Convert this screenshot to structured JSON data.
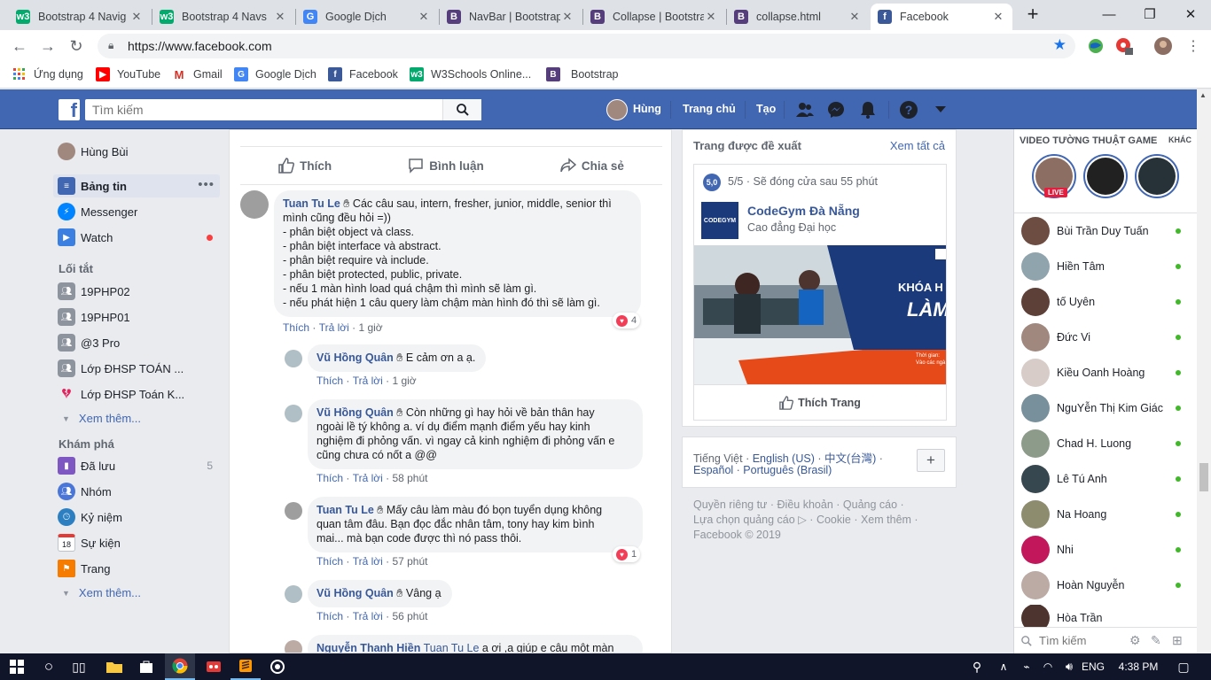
{
  "browser": {
    "tabs": [
      {
        "title": "Bootstrap 4 Navig",
        "favicon": "w3schools-icon",
        "color": "#04aa6d"
      },
      {
        "title": "Bootstrap 4 Navs",
        "favicon": "w3schools-icon",
        "color": "#04aa6d"
      },
      {
        "title": "Google Dịch",
        "favicon": "google-translate-icon",
        "color": "#4285f4"
      },
      {
        "title": "NavBar | Bootstrap",
        "favicon": "bootstrap-icon",
        "color": "#563d7c"
      },
      {
        "title": "Collapse | Bootstra",
        "favicon": "bootstrap-icon",
        "color": "#563d7c"
      },
      {
        "title": "collapse.html",
        "favicon": "bootstrap-icon",
        "color": "#563d7c"
      },
      {
        "title": "Facebook",
        "favicon": "facebook-icon",
        "color": "#3b5998"
      }
    ],
    "url": "https://www.facebook.com",
    "bookmarks": [
      {
        "label": "Ứng dụng",
        "icon": "apps-grid-icon",
        "color": "#ea4335"
      },
      {
        "label": "YouTube",
        "icon": "youtube-icon",
        "color": "#ff0000"
      },
      {
        "label": "Gmail",
        "icon": "gmail-icon",
        "color": "#d93025"
      },
      {
        "label": "Google Dịch",
        "icon": "google-translate-icon",
        "color": "#4285f4"
      },
      {
        "label": "Facebook",
        "icon": "facebook-icon",
        "color": "#3b5998"
      },
      {
        "label": "W3Schools Online...",
        "icon": "w3schools-icon",
        "color": "#04aa6d"
      },
      {
        "label": "Bootstrap",
        "icon": "bootstrap-icon",
        "color": "#563d7c"
      }
    ]
  },
  "fb": {
    "search_placeholder": "Tìm kiếm",
    "user_name": "Hùng",
    "nav_home": "Trang chủ",
    "nav_create": "Tạo",
    "brand_color": "#4267b2"
  },
  "leftnav": {
    "profile": "Hùng Bùi",
    "main": [
      {
        "label": "Bảng tin",
        "icon": "news-feed-icon"
      },
      {
        "label": "Messenger",
        "icon": "messenger-icon"
      },
      {
        "label": "Watch",
        "icon": "watch-icon"
      }
    ],
    "shortcuts_title": "Lối tắt",
    "shortcuts": [
      "19PHP02",
      "19PHP01",
      "@3 Pro",
      "Lớp ĐHSP TOÁN ...",
      "Lớp ĐHSP Toán K..."
    ],
    "see_more": "Xem thêm...",
    "explore_title": "Khám phá",
    "explore": [
      {
        "label": "Đã lưu",
        "icon": "saved-icon",
        "count": "5"
      },
      {
        "label": "Nhóm",
        "icon": "groups-icon",
        "count": ""
      },
      {
        "label": "Kỷ niệm",
        "icon": "memories-icon",
        "count": ""
      },
      {
        "label": "Sự kiện",
        "icon": "events-icon",
        "count": ""
      },
      {
        "label": "Trang",
        "icon": "pages-icon",
        "count": ""
      }
    ],
    "see_more2": "Xem thêm..."
  },
  "post": {
    "actions": {
      "like": "Thích",
      "comment": "Bình luận",
      "share": "Chia sẻ"
    },
    "comments": [
      {
        "name": "Tuan Tu Le",
        "lines": [
          "Các câu sau, intern, fresher, junior, middle, senior thì",
          "mình cũng đều hỏi =))",
          "- phân biệt object và class.",
          "- phân biệt interface và abstract.",
          "- phân biệt require và include.",
          "- phân biệt protected, public, private.",
          "- nếu 1 màn hình load quá chậm thì mình sẽ làm gì.",
          "- nếu phát hiện 1 câu query làm chậm màn hình đó thì sẽ làm gì."
        ],
        "like": "Thích",
        "reply": "Trả lời",
        "time": "1 giờ",
        "reactions": "4"
      },
      {
        "name": "Vũ Hồng Quân",
        "lines": [
          "E cảm ơn a ạ."
        ],
        "like": "Thích",
        "reply": "Trả lời",
        "time": "1 giờ"
      },
      {
        "name": "Vũ Hồng Quân",
        "lines": [
          "Còn những gì hay hỏi về bản thân hay",
          "ngoài lề tý không a. ví dụ điểm mạnh điểm yếu hay kinh",
          "nghiệm đi phỏng vấn. vì ngay cả kinh nghiệm đi phỏng vấn e",
          "cũng chưa có nốt a @@"
        ],
        "like": "Thích",
        "reply": "Trả lời",
        "time": "58 phút"
      },
      {
        "name": "Tuan Tu Le",
        "lines": [
          "Mấy câu làm màu đó bọn tuyển dụng không",
          "quan tâm đâu. Bạn đọc đắc nhân tâm, tony hay kim bình",
          "mai... mà bạn code được thì nó pass thôi."
        ],
        "like": "Thích",
        "reply": "Trả lời",
        "time": "57 phút",
        "reactions": "1"
      },
      {
        "name": "Vũ Hồng Quân",
        "lines": [
          "Vâng ạ"
        ],
        "like": "Thích",
        "reply": "Trả lời",
        "time": "56 phút"
      },
      {
        "name": "Nguyễn Thanh Hiền",
        "tag": "Tuan Tu Le",
        "lines": [
          "a ơi ,a giúp e câu một màn"
        ]
      }
    ]
  },
  "suggest": {
    "title": "Trang được đề xuất",
    "see_all": "Xem tất cả",
    "rating": "5,0",
    "rating_text": "5/5",
    "closing": "Sẽ đóng cửa sau 55 phút",
    "page_name": "CodeGym Đà Nẵng",
    "page_sub": "Cao đẳng Đại học",
    "logo_text": "CODEGYM",
    "banner_text1": "KHÓA H",
    "banner_text2": "LÀM",
    "banner_small1": "Thời gian:",
    "banner_small2": "Vào các ngà",
    "like_page": "Thích Trang"
  },
  "lang": {
    "items": [
      "Tiếng Việt",
      "English (US)",
      "中文(台灣)",
      "Español",
      "Português (Brasil)"
    ]
  },
  "footer": {
    "line1": [
      "Quyền riêng tư",
      "Điều khoản",
      "Quảng cáo"
    ],
    "line2": [
      "Lựa chọn quảng cáo",
      "Cookie",
      "Xem thêm"
    ],
    "copyright": "Facebook © 2019"
  },
  "chat": {
    "video_title": "VIDEO TƯỜNG THUẬT GAME",
    "other": "KHÁC",
    "live": "LIVE",
    "contacts": [
      "Bùi Trần Duy Tuấn",
      "Hiền Tâm",
      "tố Uyên",
      "Đức Vi",
      "Kiều Oanh Hoàng",
      "NguYễn Thị Kim Giác",
      "Chad H. Luong",
      "Lê Tú Anh",
      "Na Hoang",
      "Nhi",
      "Hoàn Nguyễn",
      "Hòa Trần"
    ],
    "search_placeholder": "Tìm kiếm"
  },
  "taskbar": {
    "lang": "ENG",
    "time": "4:38 PM"
  }
}
